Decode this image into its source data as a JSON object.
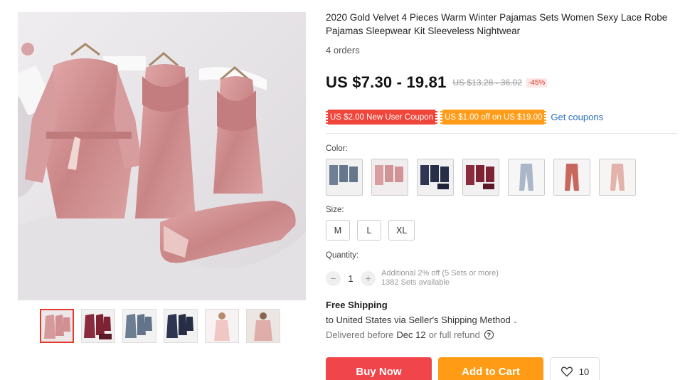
{
  "product": {
    "title": "2020 Gold Velvet 4 Pieces Warm Winter Pajamas Sets Women Sexy Lace Robe Pajamas Sleepwear Kit Sleeveless Nightwear",
    "orders": "4 orders"
  },
  "price": {
    "current": "US $7.30 - 19.81",
    "original": "US $13.28 - 36.02",
    "discount": "-45%"
  },
  "coupons": {
    "new_user": "US $2.00 New User Coupon",
    "store": "US $1.00 off on US $19.00",
    "get_link": "Get coupons"
  },
  "color": {
    "label": "Color:",
    "options": [
      "gray-blue set",
      "pink set",
      "navy set",
      "wine set",
      "light blue pants",
      "brick pants",
      "pink pants"
    ]
  },
  "size": {
    "label": "Size:",
    "options": [
      "M",
      "L",
      "XL"
    ]
  },
  "quantity": {
    "label": "Quantity:",
    "value": "1",
    "minus": "−",
    "plus": "+",
    "note_discount": "Additional 2% off (5 Sets or more)",
    "note_stock": "1382 Sets available"
  },
  "shipping": {
    "title": "Free Shipping",
    "destination": "to United States via Seller's Shipping Method",
    "delivered_prefix": "Delivered before",
    "delivered_date": "Dec 12",
    "delivered_suffix": "or full refund"
  },
  "actions": {
    "buy_now": "Buy Now",
    "add_to_cart": "Add to Cart",
    "wishlist_count": "10"
  },
  "colors": {
    "accent_red": "#f0454a",
    "accent_orange": "#ff9b14",
    "link_blue": "#2a6ebb"
  }
}
